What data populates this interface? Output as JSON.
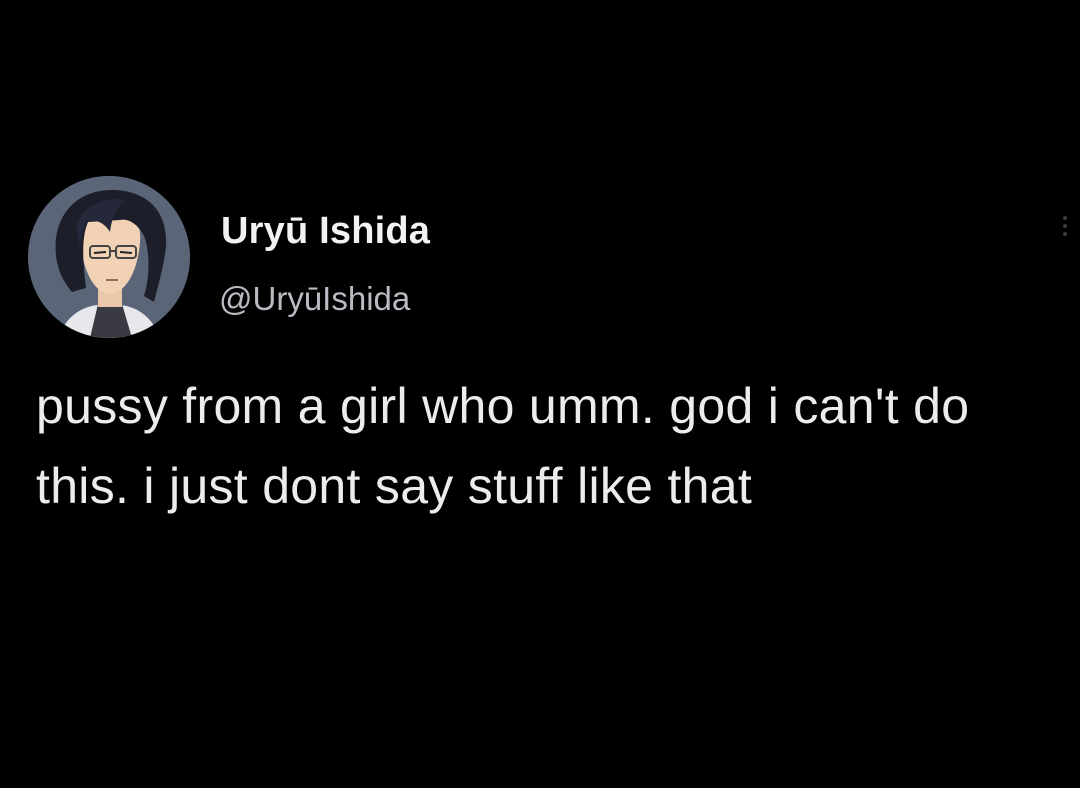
{
  "tweet": {
    "author": {
      "display_name": "Uryū Ishida",
      "handle": "@UryūIshida",
      "avatar_icon": "anime-character-avatar-icon"
    },
    "text": "pussy from a girl who umm. god i can't do this. i just dont say stuff like that",
    "more_icon": "more-options-icon"
  },
  "colors": {
    "background": "#000000",
    "text_primary": "#ececec",
    "text_secondary": "#b8bcc2"
  }
}
